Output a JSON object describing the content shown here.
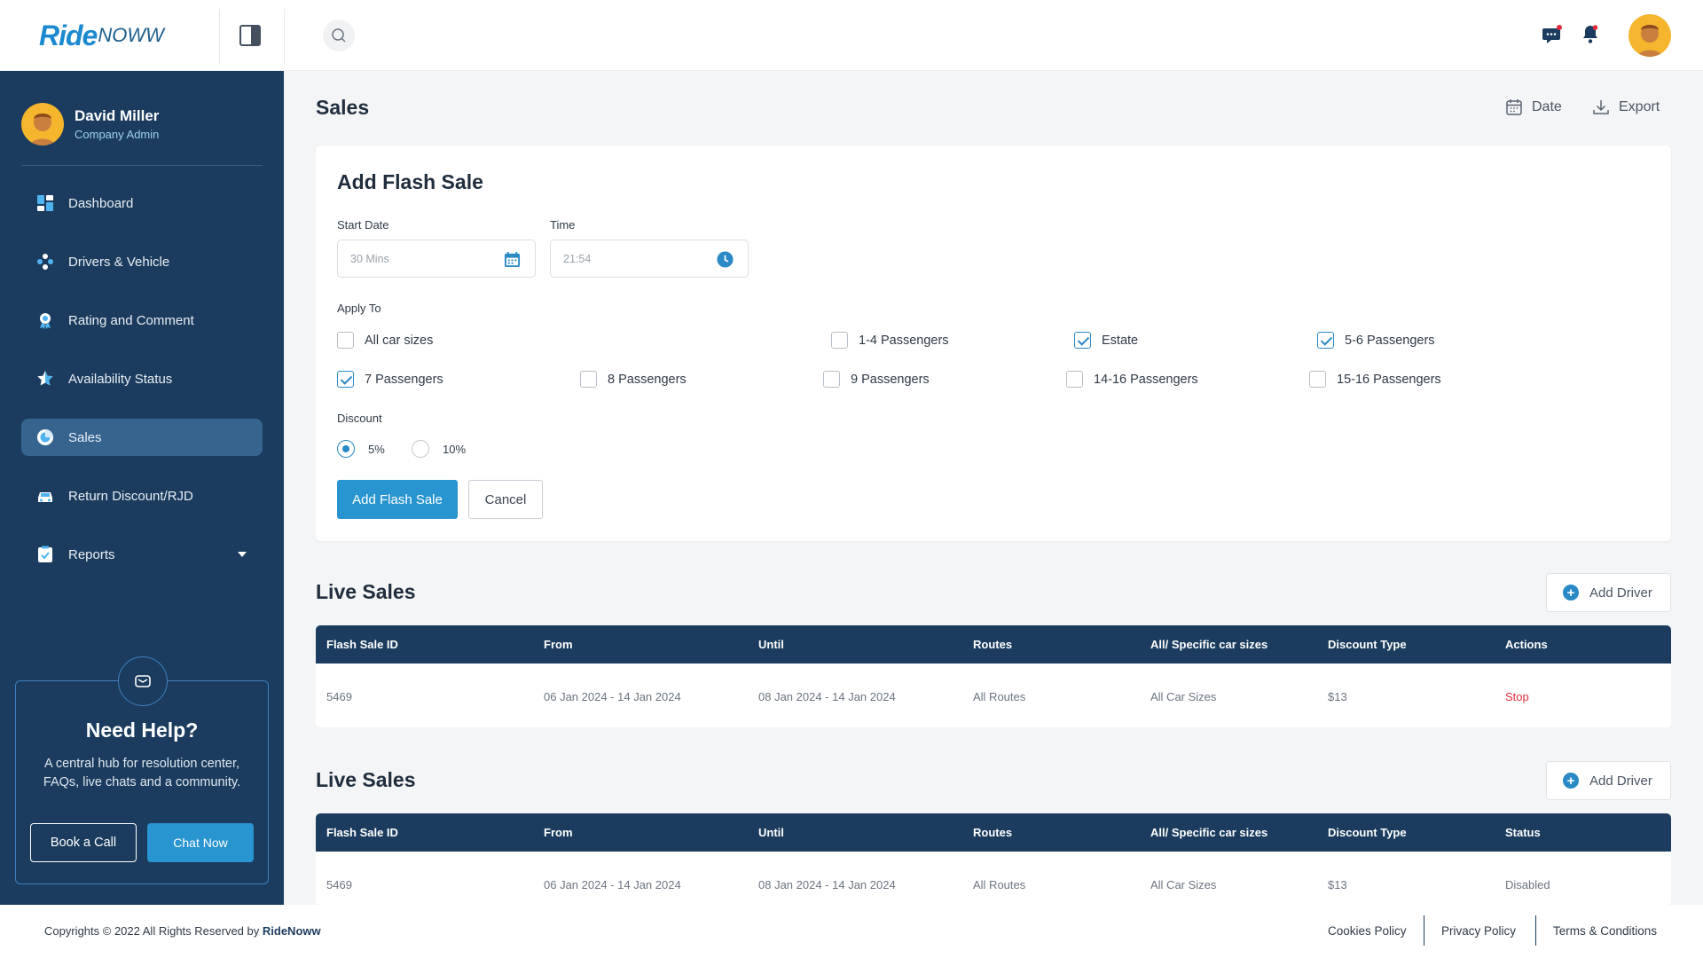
{
  "app": {
    "logo_main": "Ride",
    "logo_sub": "NOWW"
  },
  "colors": {
    "sidebar": "#1b3c5e",
    "accent": "#2894d0",
    "danger": "#e02b3a"
  },
  "topbar": {
    "icons": [
      "panel-toggle-icon",
      "search-icon",
      "chat-icon",
      "bell-icon"
    ]
  },
  "profile": {
    "name": "David Miller",
    "role": "Company Admin"
  },
  "sidebar": {
    "items": [
      {
        "label": "Dashboard",
        "icon": "dashboard-icon"
      },
      {
        "label": "Drivers & Vehicle",
        "icon": "drivers-icon"
      },
      {
        "label": "Rating and Comment",
        "icon": "rating-icon"
      },
      {
        "label": "Availability Status",
        "icon": "star-icon"
      },
      {
        "label": "Sales",
        "icon": "sales-icon",
        "active": true
      },
      {
        "label": "Return Discount/RJD",
        "icon": "car-icon"
      },
      {
        "label": "Reports",
        "icon": "reports-icon",
        "expandable": true
      }
    ]
  },
  "help": {
    "title": "Need Help?",
    "text": "A central hub for resolution center, FAQs, live chats and a community.",
    "book_label": "Book a Call",
    "chat_label": "Chat Now"
  },
  "page": {
    "title": "Sales",
    "date_label": "Date",
    "export_label": "Export"
  },
  "flash_form": {
    "title": "Add Flash Sale",
    "start_date_label": "Start Date",
    "start_date_value": "30 Mins",
    "time_label": "Time",
    "time_value": "21:54",
    "apply_to_label": "Apply To",
    "options": [
      {
        "label": "All car sizes",
        "checked": false
      },
      {
        "label": "1-4 Passengers",
        "checked": false
      },
      {
        "label": "Estate",
        "checked": true
      },
      {
        "label": "5-6 Passengers",
        "checked": true
      },
      {
        "label": "7 Passengers",
        "checked": true
      },
      {
        "label": "8 Passengers",
        "checked": false
      },
      {
        "label": "9 Passengers",
        "checked": false
      },
      {
        "label": "14-16 Passengers",
        "checked": false
      },
      {
        "label": "15-16 Passengers",
        "checked": false
      }
    ],
    "discount_label": "Discount",
    "discounts": [
      {
        "label": "5%",
        "selected": true
      },
      {
        "label": "10%",
        "selected": false
      }
    ],
    "submit_label": "Add Flash Sale",
    "cancel_label": "Cancel"
  },
  "live_sales": {
    "title": "Live Sales",
    "add_driver_label": "Add Driver",
    "columns": [
      "Flash Sale ID",
      "From",
      "Until",
      "Routes",
      "All/ Specific car sizes",
      "Discount Type",
      "Actions"
    ],
    "rows": [
      [
        "5469",
        "06 Jan 2024 - 14 Jan 2024",
        "08 Jan 2024 - 14 Jan 2024",
        "All Routes",
        "All Car Sizes",
        "$13",
        "Stop"
      ]
    ]
  },
  "live_sales_2": {
    "title": "Live Sales",
    "add_driver_label": "Add Driver",
    "columns": [
      "Flash Sale ID",
      "From",
      "Until",
      "Routes",
      "All/ Specific car sizes",
      "Discount Type",
      "Status"
    ],
    "rows": [
      [
        "5469",
        "06 Jan 2024 - 14 Jan 2024",
        "08 Jan 2024 - 14 Jan 2024",
        "All Routes",
        "All Car Sizes",
        "$13",
        "Disabled"
      ]
    ]
  },
  "footer": {
    "copyright_prefix": "Copyrights © 2022 All Rights Reserved by",
    "copyright_brand": "RideNoww",
    "links": [
      "Cookies Policy",
      "Privacy Policy",
      "Terms & Conditions"
    ]
  }
}
